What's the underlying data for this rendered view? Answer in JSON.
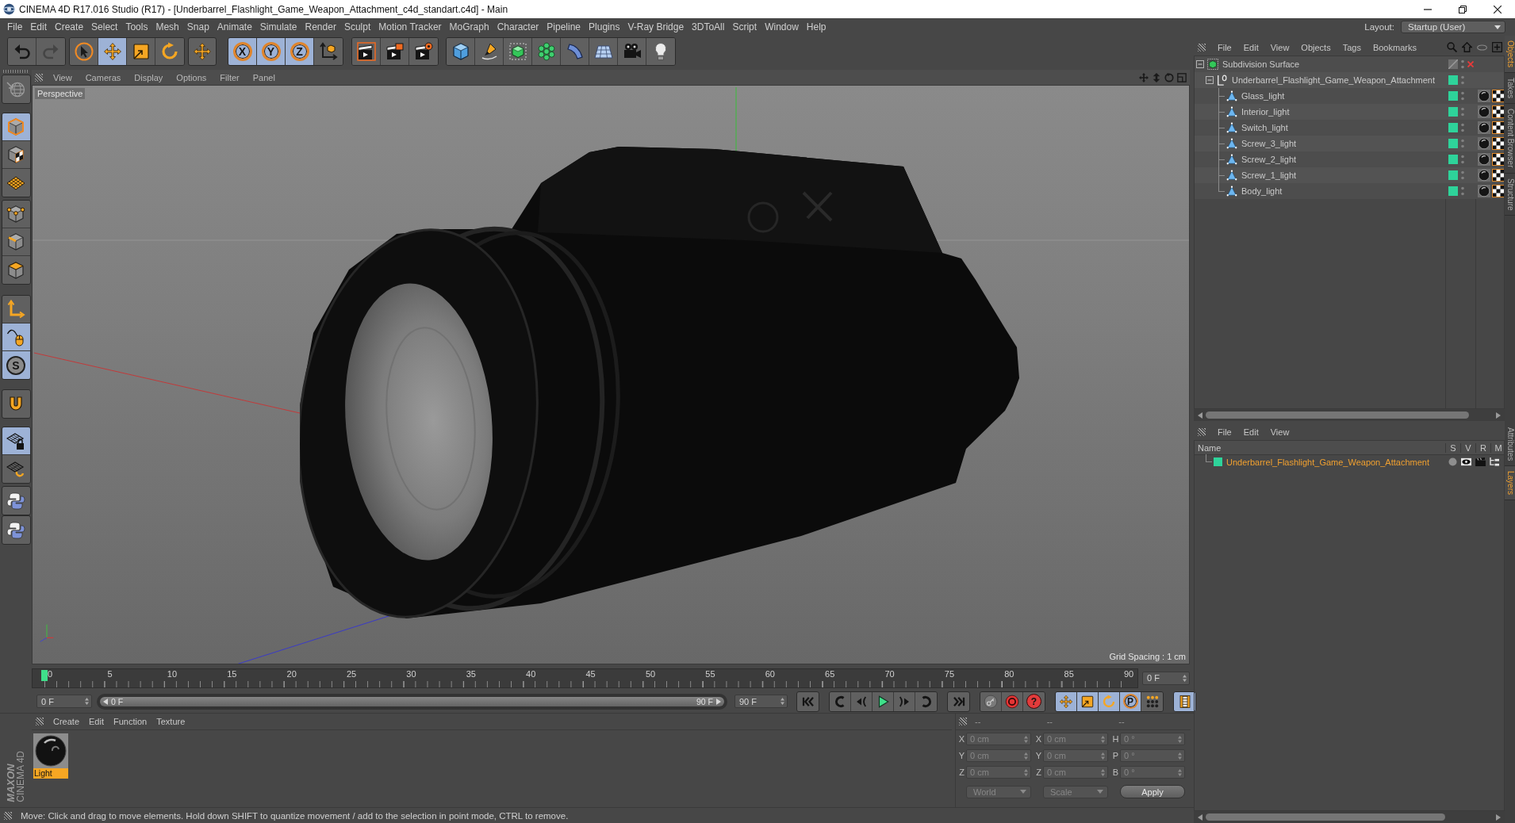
{
  "window": {
    "title": "CINEMA 4D R17.016 Studio (R17) - [Underbarrel_Flashlight_Game_Weapon_Attachment_c4d_standart.c4d] - Main"
  },
  "menu_bar": {
    "items": [
      "File",
      "Edit",
      "Create",
      "Select",
      "Tools",
      "Mesh",
      "Snap",
      "Animate",
      "Simulate",
      "Render",
      "Sculpt",
      "Motion Tracker",
      "MoGraph",
      "Character",
      "Pipeline",
      "Plugins",
      "V-Ray Bridge",
      "3DToAll",
      "Script",
      "Window",
      "Help"
    ],
    "layout_label": "Layout:",
    "layout_value": "Startup (User)"
  },
  "toolbar": {
    "groups": [
      [
        {
          "kind": "undo",
          "disabled": false
        },
        {
          "kind": "redo",
          "disabled": true
        }
      ],
      [
        {
          "kind": "live_selection",
          "selected": false
        },
        {
          "kind": "move",
          "selected": true
        },
        {
          "kind": "scale",
          "selected": false
        },
        {
          "kind": "rotate",
          "selected": false
        }
      ],
      [
        {
          "kind": "recent_tool",
          "selected": false
        }
      ],
      [
        {
          "kind": "axis_lock",
          "label": "X",
          "selected": true
        },
        {
          "kind": "axis_lock",
          "label": "Y",
          "selected": true
        },
        {
          "kind": "axis_lock",
          "label": "Z",
          "selected": true
        },
        {
          "kind": "coordinate_system",
          "selected": false
        }
      ],
      [
        {
          "kind": "render_view"
        },
        {
          "kind": "render_picture_viewer"
        },
        {
          "kind": "render_settings"
        }
      ],
      [
        {
          "kind": "cube"
        },
        {
          "kind": "pen"
        },
        {
          "kind": "subdivision"
        },
        {
          "kind": "cloner"
        },
        {
          "kind": "bend"
        },
        {
          "kind": "floor"
        },
        {
          "kind": "camera"
        },
        {
          "kind": "light"
        }
      ]
    ]
  },
  "left_tools": {
    "groups": [
      [
        {
          "kind": "make_editable"
        }
      ],
      [
        {
          "kind": "model_mode",
          "selected": true
        },
        {
          "kind": "texture_mode",
          "selected": false
        },
        {
          "kind": "workplane_mode",
          "selected": false
        }
      ],
      [
        {
          "kind": "points_mode",
          "selected": false
        },
        {
          "kind": "edges_mode",
          "selected": false
        },
        {
          "kind": "polygons_mode",
          "selected": false
        }
      ],
      [
        {
          "kind": "axis_mode",
          "selected": false
        },
        {
          "kind": "tweak",
          "selected": true
        },
        {
          "kind": "snap",
          "label": "S",
          "selected": true
        }
      ],
      [
        {
          "kind": "magnet",
          "selected": false
        }
      ],
      [
        {
          "kind": "lock_workplane",
          "selected": true
        },
        {
          "kind": "planar_workplane",
          "selected": false
        }
      ],
      [
        {
          "kind": "python"
        }
      ],
      [
        {
          "kind": "python"
        }
      ]
    ]
  },
  "viewport": {
    "menu": [
      "View",
      "Cameras",
      "Display",
      "Options",
      "Filter",
      "Panel"
    ],
    "camera": "Perspective",
    "grid_spacing": "Grid Spacing : 1 cm"
  },
  "timeline": {
    "ticks": [
      "0",
      "5",
      "10",
      "15",
      "20",
      "25",
      "30",
      "35",
      "40",
      "45",
      "50",
      "55",
      "60",
      "65",
      "70",
      "75",
      "80",
      "85",
      "90"
    ],
    "playhead": {
      "level": 0
    },
    "current_frame": "0 F"
  },
  "playback": {
    "start_frame": "0 F",
    "range": {
      "start": "0 F",
      "end": "90 F",
      "level": 1
    },
    "end_frame": "90 F",
    "buttons": [
      [
        {
          "kind": "go_start"
        }
      ],
      [
        {
          "kind": "prev_key"
        },
        {
          "kind": "prev_frame"
        },
        {
          "kind": "play"
        },
        {
          "kind": "next_frame"
        },
        {
          "kind": "next_key"
        }
      ],
      [
        {
          "kind": "go_end"
        }
      ],
      [
        {
          "kind": "record_key"
        },
        {
          "kind": "autokey"
        },
        {
          "kind": "key_selection",
          "label": "?"
        }
      ],
      [
        {
          "kind": "key_move",
          "selected": true
        },
        {
          "kind": "key_scale",
          "selected": true
        },
        {
          "kind": "key_rotate",
          "selected": true
        },
        {
          "kind": "key_param",
          "label": "P",
          "selected": true
        },
        {
          "kind": "key_points",
          "selected": false
        }
      ],
      [
        {
          "kind": "timeline",
          "selected": true
        }
      ]
    ]
  },
  "logo": {
    "brand": "MAXON",
    "product": "CINEMA 4D"
  },
  "materials": {
    "menu": [
      "Create",
      "Edit",
      "Function",
      "Texture"
    ],
    "items": [
      {
        "name": "Light",
        "selected": true
      }
    ]
  },
  "coordinates": {
    "headers": [
      "--",
      "--",
      "--"
    ],
    "disabled": true,
    "rows": [
      {
        "position_axis": "X",
        "position": "0 cm",
        "size_axis": "X",
        "size": "0 cm",
        "rotation_axis": "H",
        "rotation": "0 °"
      },
      {
        "position_axis": "Y",
        "position": "0 cm",
        "size_axis": "Y",
        "size": "0 cm",
        "rotation_axis": "P",
        "rotation": "0 °"
      },
      {
        "position_axis": "Z",
        "position": "0 cm",
        "size_axis": "Z",
        "size": "0 cm",
        "rotation_axis": "B",
        "rotation": "0 °"
      }
    ],
    "mode": "World",
    "size_mode": "Scale",
    "apply": "Apply"
  },
  "status_bar": {
    "text": "Move: Click and drag to move elements. Hold down SHIFT to quantize movement / add to the selection in point mode, CTRL to remove."
  },
  "object_manager": {
    "menu": [
      "File",
      "Edit",
      "View",
      "Objects",
      "Tags",
      "Bookmarks"
    ],
    "objects": [
      {
        "name": "Subdivision Surface",
        "kind": "subdivision",
        "expanded": true,
        "on_layer": false,
        "enabled": false,
        "children": [
          {
            "name": "Underbarrel_Flashlight_Game_Weapon_Attachment",
            "kind": "null",
            "expanded": true,
            "on_layer": true,
            "children": [
              {
                "name": "Glass_light",
                "kind": "polygon",
                "on_layer": true,
                "tags": [
                  {
                    "kind": "material"
                  },
                  {
                    "kind": "uvw"
                  }
                ]
              },
              {
                "name": "Interior_light",
                "kind": "polygon",
                "on_layer": true,
                "tags": [
                  {
                    "kind": "material"
                  },
                  {
                    "kind": "uvw"
                  }
                ]
              },
              {
                "name": "Switch_light",
                "kind": "polygon",
                "on_layer": true,
                "tags": [
                  {
                    "kind": "material"
                  },
                  {
                    "kind": "uvw"
                  }
                ]
              },
              {
                "name": "Screw_3_light",
                "kind": "polygon",
                "on_layer": true,
                "tags": [
                  {
                    "kind": "material"
                  },
                  {
                    "kind": "uvw"
                  }
                ]
              },
              {
                "name": "Screw_2_light",
                "kind": "polygon",
                "on_layer": true,
                "tags": [
                  {
                    "kind": "material"
                  },
                  {
                    "kind": "uvw"
                  }
                ]
              },
              {
                "name": "Screw_1_light",
                "kind": "polygon",
                "on_layer": true,
                "tags": [
                  {
                    "kind": "material"
                  },
                  {
                    "kind": "uvw"
                  }
                ]
              },
              {
                "name": "Body_light",
                "kind": "polygon",
                "on_layer": true,
                "tags": [
                  {
                    "kind": "material"
                  },
                  {
                    "kind": "uvw"
                  }
                ]
              }
            ]
          }
        ]
      }
    ]
  },
  "layer_manager": {
    "menu": [
      "File",
      "Edit",
      "View"
    ],
    "columns": [
      "Name",
      "S",
      "V",
      "R",
      "M"
    ],
    "layers": [
      {
        "name": "Underbarrel_Flashlight_Game_Weapon_Attachment",
        "color": "#2ed39a",
        "selected": true
      }
    ]
  },
  "side_tabs": {
    "upper": [
      {
        "label": "Objects",
        "selected": true
      },
      {
        "label": "Takes",
        "selected": false
      },
      {
        "label": "Content Browser",
        "selected": false
      },
      {
        "label": "Structure",
        "selected": false
      }
    ],
    "lower": [
      {
        "label": "Attributes",
        "selected": false
      },
      {
        "label": "Layers",
        "selected": true
      }
    ]
  }
}
